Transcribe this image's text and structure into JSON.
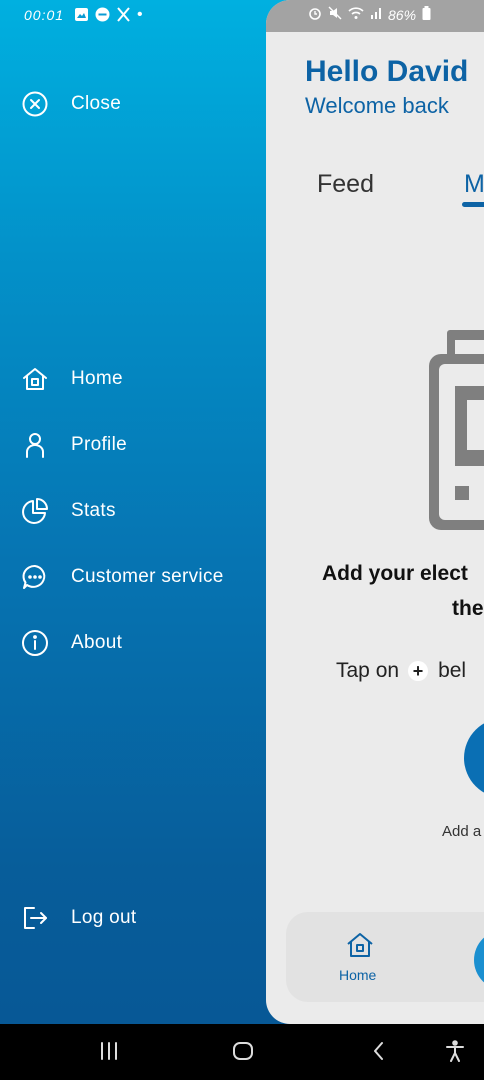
{
  "status_bar": {
    "time": "00:01",
    "battery": "86%",
    "left_icons": [
      "gallery-icon",
      "do-not-disturb-icon",
      "x-icon",
      "dot-icon"
    ],
    "right_icons": [
      "alarm-icon",
      "mute-icon",
      "wifi-icon",
      "signal-icon",
      "battery-icon"
    ]
  },
  "drawer": {
    "close_label": "Close",
    "items": [
      {
        "label": "Home",
        "icon": "home-icon"
      },
      {
        "label": "Profile",
        "icon": "person-icon"
      },
      {
        "label": "Stats",
        "icon": "pie-chart-icon"
      },
      {
        "label": "Customer service",
        "icon": "chat-bubble-icon"
      },
      {
        "label": "About",
        "icon": "info-icon"
      }
    ],
    "logout_label": "Log out",
    "gradient_top": "#00b0e0",
    "gradient_bottom": "#075896"
  },
  "main": {
    "greeting": "Hello David",
    "subtitle": "Welcome back",
    "tabs": [
      {
        "label": "Feed",
        "active": false
      },
      {
        "label": "M",
        "active": true
      }
    ],
    "empty_title_line1": "Add your elect",
    "empty_title_line2": "the",
    "tap_prefix": "Tap on",
    "tap_suffix": "bel",
    "add_label": "Add a",
    "accent": "#0d63a5"
  },
  "bottom_nav": {
    "home_label": "Home"
  }
}
